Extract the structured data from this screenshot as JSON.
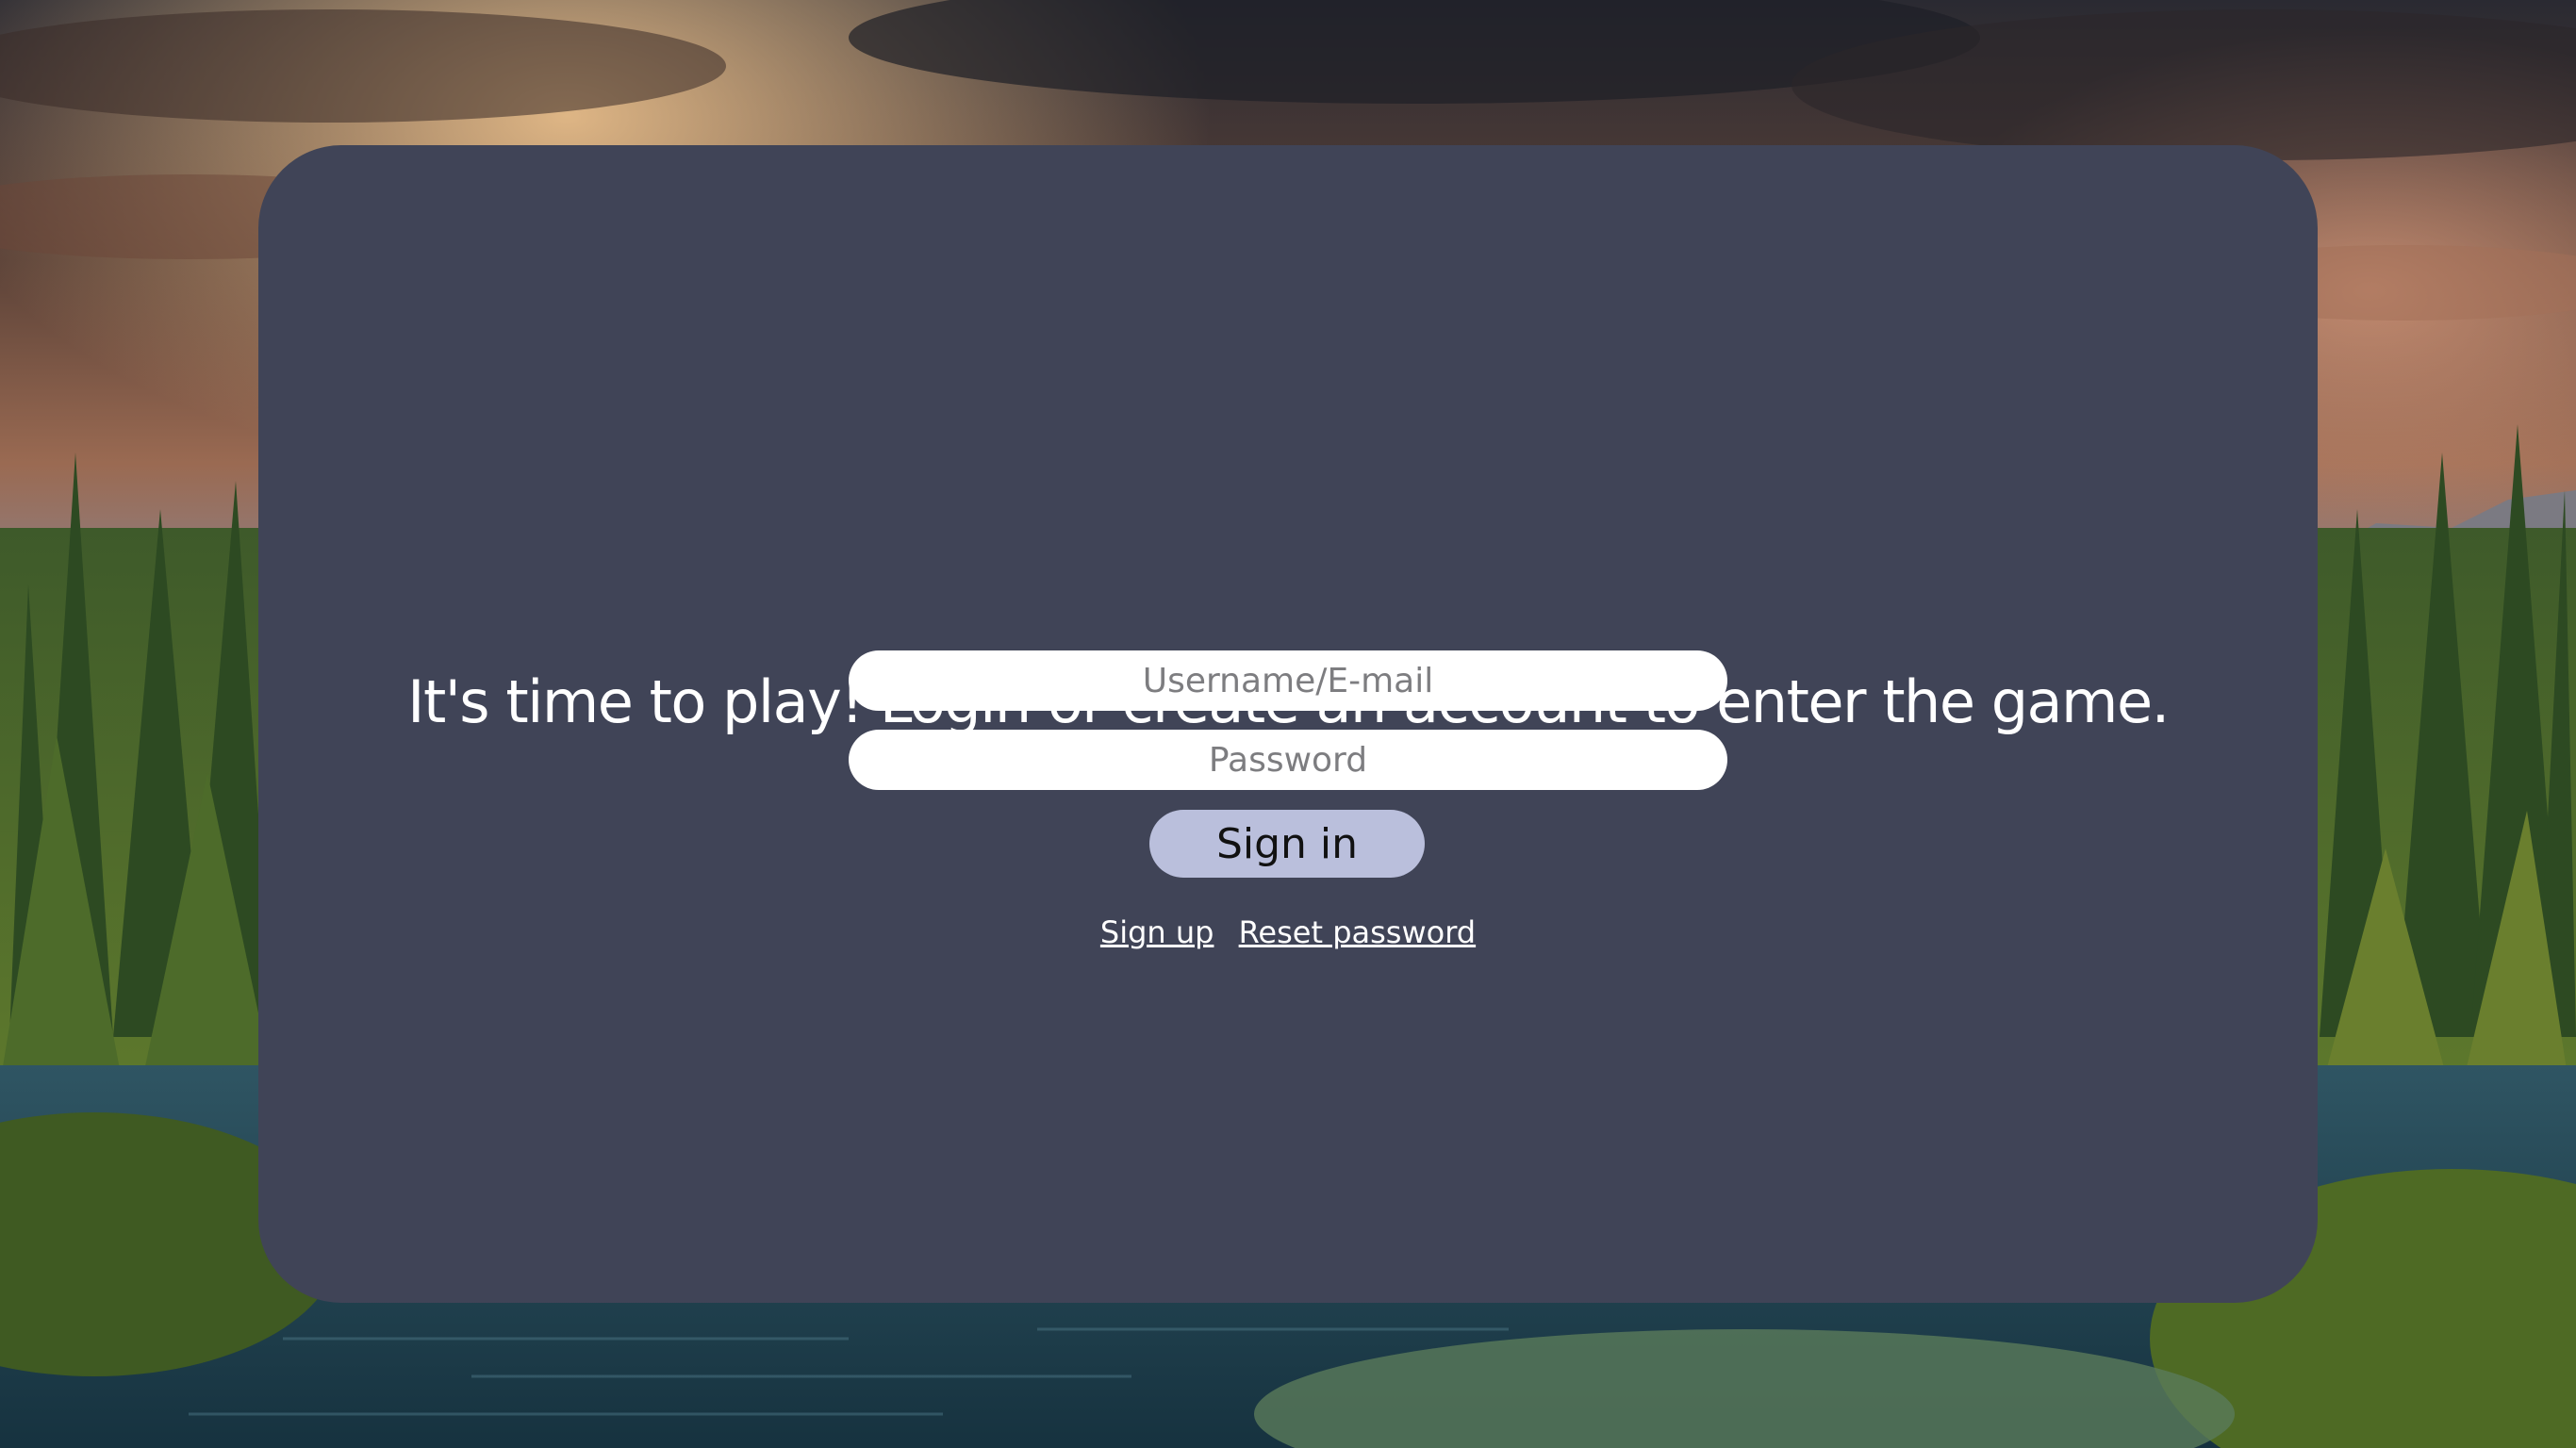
{
  "login": {
    "headline": "It's time to play! Login or create an account to enter the game.",
    "username_placeholder": "Username/E-mail",
    "password_placeholder": "Password",
    "sign_in_label": "Sign in",
    "sign_up_link": "Sign up",
    "reset_password_link": "Reset password"
  },
  "theme": {
    "panel_color": "#404457",
    "button_color": "#babfdc",
    "input_color": "#ffffff",
    "text_color": "#ffffff"
  },
  "background": {
    "description_icon": "landscape-photo"
  }
}
